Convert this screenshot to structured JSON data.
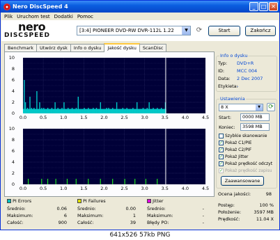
{
  "window": {
    "title": "Nero DiscSpeed 4",
    "minimize": "_",
    "maximize": "□",
    "close": "✕"
  },
  "menu": [
    "Plik",
    "Uruchom test",
    "Dodatki",
    "Pomoc"
  ],
  "logo": {
    "top": "nero",
    "bottom": "DISCSPEED"
  },
  "drive": {
    "value": "[3:4]  PIONEER DVD-RW  DVR-112L 1.22"
  },
  "buttons": {
    "start": "Start",
    "close": "Zakończ",
    "advanced": "Zaawansowane"
  },
  "tabs": [
    "Benchmark",
    "Utwórz dysk",
    "Info o dysku",
    "Jakość dysku",
    "ScanDisc"
  ],
  "active_tab": 3,
  "disc_info": {
    "title": "Info o dysku",
    "rows": [
      {
        "label": "Typ:",
        "value": "DVD+R"
      },
      {
        "label": "ID:",
        "value": "MCC 004"
      },
      {
        "label": "Data:",
        "value": "2 Dec 2007"
      },
      {
        "label": "Etykieta:",
        "value": "-"
      }
    ]
  },
  "settings": {
    "title": "Ustawienia",
    "speed": "8 X",
    "start_label": "Start:",
    "start_value": "0000 MB",
    "end_label": "Koniec:",
    "end_value": "3598 MB",
    "checks": [
      {
        "label": "Szybkie skanowanie",
        "checked": false,
        "disabled": false
      },
      {
        "label": "Pokaż C1/PIE",
        "checked": true,
        "disabled": false
      },
      {
        "label": "Pokaż C2/PIF",
        "checked": true,
        "disabled": false
      },
      {
        "label": "Pokaż Jitter",
        "checked": true,
        "disabled": false
      },
      {
        "label": "Pokaż prędkość odczyt",
        "checked": true,
        "disabled": false
      },
      {
        "label": "Pokaż prędkość zapisu",
        "checked": true,
        "disabled": true
      }
    ]
  },
  "quality": {
    "label": "Ocena jakości:",
    "value": "98"
  },
  "stats": {
    "pi_errors": {
      "title": "PI Errors",
      "color": "#00c0c0",
      "avg_label": "Średnio:",
      "avg": "0.06",
      "max_label": "Maksimum:",
      "max": "6",
      "total_label": "Całość:",
      "total": "900"
    },
    "pi_failures": {
      "title": "PI Failures",
      "color": "#e0e000",
      "avg_label": "Średnio:",
      "avg": "0.00",
      "max_label": "Maksimum:",
      "max": "1",
      "total_label": "Całość:",
      "total": "39"
    },
    "jitter": {
      "title": "Jitter",
      "color": "#e000e0",
      "avg_label": "Średnio:",
      "avg": "-",
      "max_label": "Maksimum:",
      "max": "-",
      "bledy_label": "Błędy PO:",
      "bledy": "-"
    }
  },
  "progress": {
    "postep_label": "Postęp:",
    "postep": "100 %",
    "polozenie_label": "Położenie:",
    "polozenie": "3597 MB",
    "predkosc_label": "Prędkość:",
    "predkosc": "11.04 X"
  },
  "caption": "641x526  57kb  PNG",
  "chart_data": [
    {
      "type": "bar",
      "title": "PI Errors",
      "xlabel": "",
      "ylabel": "",
      "xlim": [
        0,
        4.5
      ],
      "ylim": [
        0,
        10
      ],
      "x_ticks": [
        "0.0",
        "0.5",
        "1.0",
        "1.5",
        "2.0",
        "2.5",
        "3.0",
        "3.5",
        "4.0",
        "4.5"
      ],
      "y_ticks": [
        "10",
        "8",
        "6",
        "4",
        "2",
        "0"
      ],
      "grid": true,
      "color": "#00c8c8",
      "end_marker": 3.52,
      "x": [
        0.02,
        0.05,
        0.1,
        0.16,
        0.2,
        0.26,
        0.33,
        0.4,
        0.45,
        0.5,
        0.6,
        0.7,
        0.78,
        0.85,
        0.95,
        1.0,
        1.1,
        1.2,
        1.3,
        1.35,
        1.5,
        1.6,
        1.72,
        1.8,
        1.9,
        2.05,
        2.1,
        2.2,
        2.3,
        2.45,
        2.55,
        2.7,
        2.8,
        2.95,
        3.05,
        3.1,
        3.2,
        3.3,
        3.4,
        3.5
      ],
      "values": [
        6,
        2,
        1,
        3,
        1,
        1,
        4,
        2,
        1,
        1,
        1,
        1,
        2,
        1,
        1,
        2,
        1,
        1,
        1,
        3,
        1,
        1,
        1,
        1,
        2,
        1,
        1,
        1,
        2,
        1,
        1,
        1,
        2,
        1,
        1,
        2,
        1,
        1,
        1,
        2
      ]
    },
    {
      "type": "bar",
      "title": "PI Failures",
      "xlabel": "",
      "ylabel": "",
      "xlim": [
        0,
        4.5
      ],
      "ylim": [
        0,
        10
      ],
      "x_ticks": [
        "0.0",
        "0.5",
        "1.0",
        "1.5",
        "2.0",
        "2.5",
        "3.0",
        "3.5",
        "4.0",
        "4.5"
      ],
      "y_ticks": [
        "10",
        "8",
        "6",
        "4",
        "2",
        "0"
      ],
      "grid": true,
      "color": "#20e020",
      "end_marker": 3.52,
      "x": [
        0.12,
        0.45,
        0.6,
        0.8,
        1.08,
        1.3,
        1.6,
        1.9,
        2.2,
        2.5,
        2.75,
        3.02,
        3.3
      ],
      "values": [
        1,
        1,
        1,
        1,
        1,
        1,
        1,
        1,
        1,
        1,
        1,
        1,
        1
      ]
    }
  ]
}
